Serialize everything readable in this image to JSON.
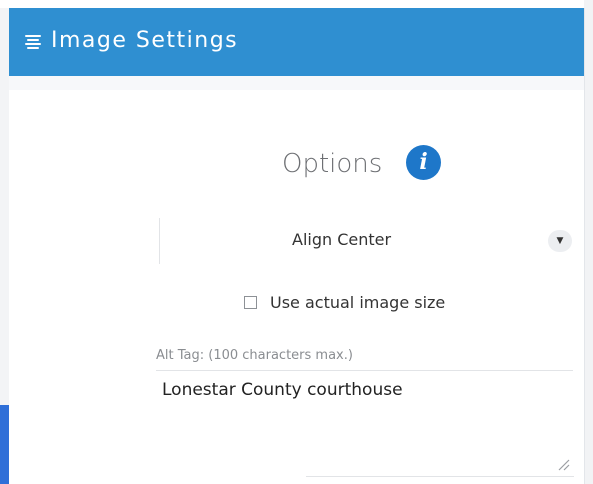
{
  "header": {
    "title": "Image Settings",
    "icon": "list-menu-icon",
    "background_color": "#2f8fd1"
  },
  "options": {
    "label": "Options",
    "info_icon": "info-icon",
    "info_glyph": "i",
    "info_color": "#1e77c9"
  },
  "alignment": {
    "selected": "Align Center",
    "arrow_icon": "dropdown-arrow-icon",
    "arrow_glyph": "▼"
  },
  "actual_size": {
    "label": "Use actual image size",
    "checked": false
  },
  "alt_tag": {
    "label": "Alt Tag: (100 characters max.)",
    "value": "Lonestar County courthouse"
  }
}
